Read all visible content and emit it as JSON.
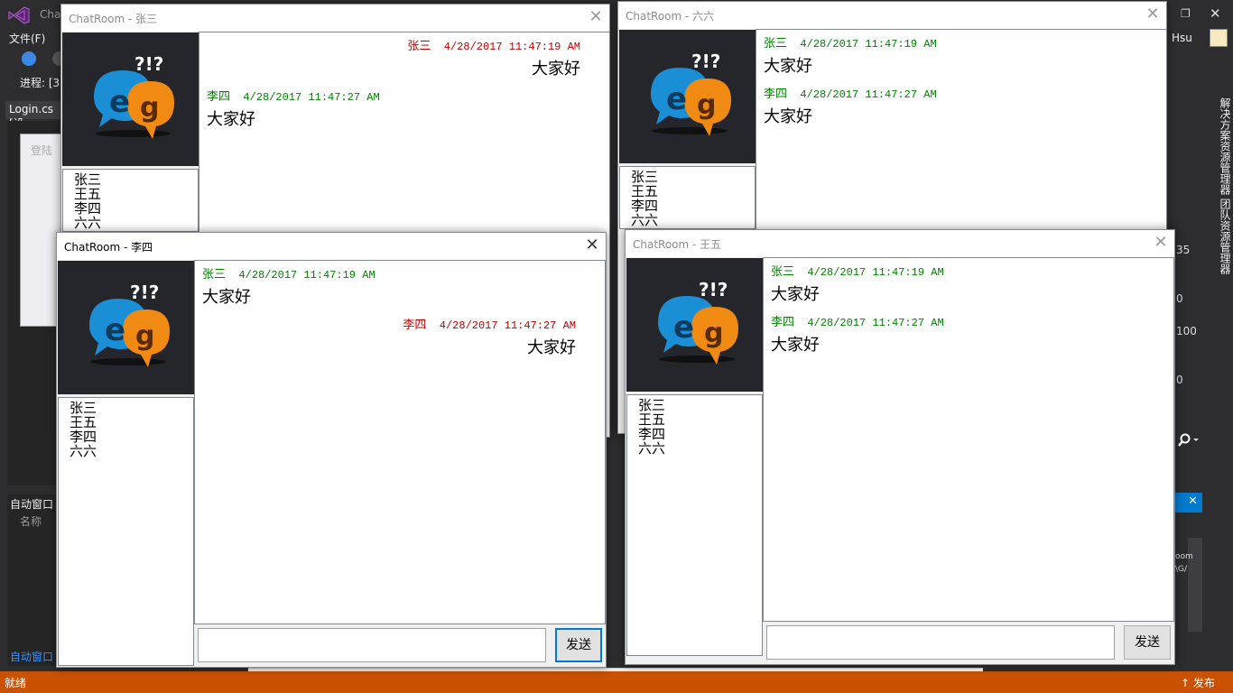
{
  "vs": {
    "title": "Chat",
    "menu_file": "文件(F)",
    "progress_label": "进程:",
    "progress_value": "[3",
    "file_tab": "Login.cs [设",
    "designer_caption": "登陆",
    "auto_window_title": "自动窗口",
    "auto_window_column": "名称",
    "auto_window_tab": "自动窗口",
    "status_ready": "就绪",
    "status_publish": "↑ 发布",
    "user_name": "Hsu",
    "right_panel_text": "解决方案资源管理器 团队资源管理器",
    "prop_values": [
      "35",
      "0",
      "100",
      "0"
    ],
    "output_lines": [
      "oom",
      "\\G/"
    ]
  },
  "windows": [
    {
      "title": "ChatRoom - 张三",
      "active": false,
      "users": [
        "张三",
        "王五",
        "李四",
        "六六"
      ],
      "messages": [
        {
          "sender": "张三",
          "time": "4/28/2017 11:47:19 AM",
          "text": "大家好",
          "self": true
        },
        {
          "sender": "李四",
          "time": "4/28/2017 11:47:27 AM",
          "text": "大家好",
          "self": false
        }
      ]
    },
    {
      "title": "ChatRoom - 六六",
      "active": false,
      "users": [
        "张三",
        "王五",
        "李四",
        "六六"
      ],
      "messages": [
        {
          "sender": "张三",
          "time": "4/28/2017 11:47:19 AM",
          "text": "大家好",
          "self": false
        },
        {
          "sender": "李四",
          "time": "4/28/2017 11:47:27 AM",
          "text": "大家好",
          "self": false
        }
      ]
    },
    {
      "title": "ChatRoom - 李四",
      "active": true,
      "users": [
        "张三",
        "王五",
        "李四",
        "六六"
      ],
      "messages": [
        {
          "sender": "张三",
          "time": "4/28/2017 11:47:19 AM",
          "text": "大家好",
          "self": false
        },
        {
          "sender": "李四",
          "time": "4/28/2017 11:47:27 AM",
          "text": "大家好",
          "self": true
        }
      ],
      "send_label": "发送",
      "input_value": ""
    },
    {
      "title": "ChatRoom - 王五",
      "active": false,
      "users": [
        "张三",
        "王五",
        "李四",
        "六六"
      ],
      "messages": [
        {
          "sender": "张三",
          "time": "4/28/2017 11:47:19 AM",
          "text": "大家好",
          "self": false
        },
        {
          "sender": "李四",
          "time": "4/28/2017 11:47:27 AM",
          "text": "大家好",
          "self": false
        }
      ],
      "send_label": "发送",
      "input_value": ""
    }
  ],
  "colors": {
    "self_header": "#c00000",
    "other_header": "#008000",
    "status_bar": "#ca5100",
    "accent": "#007acc"
  },
  "icons": {
    "app_logo": "chat-bubbles-e-g-logo",
    "close": "close-icon",
    "vs": "visual-studio-icon"
  }
}
